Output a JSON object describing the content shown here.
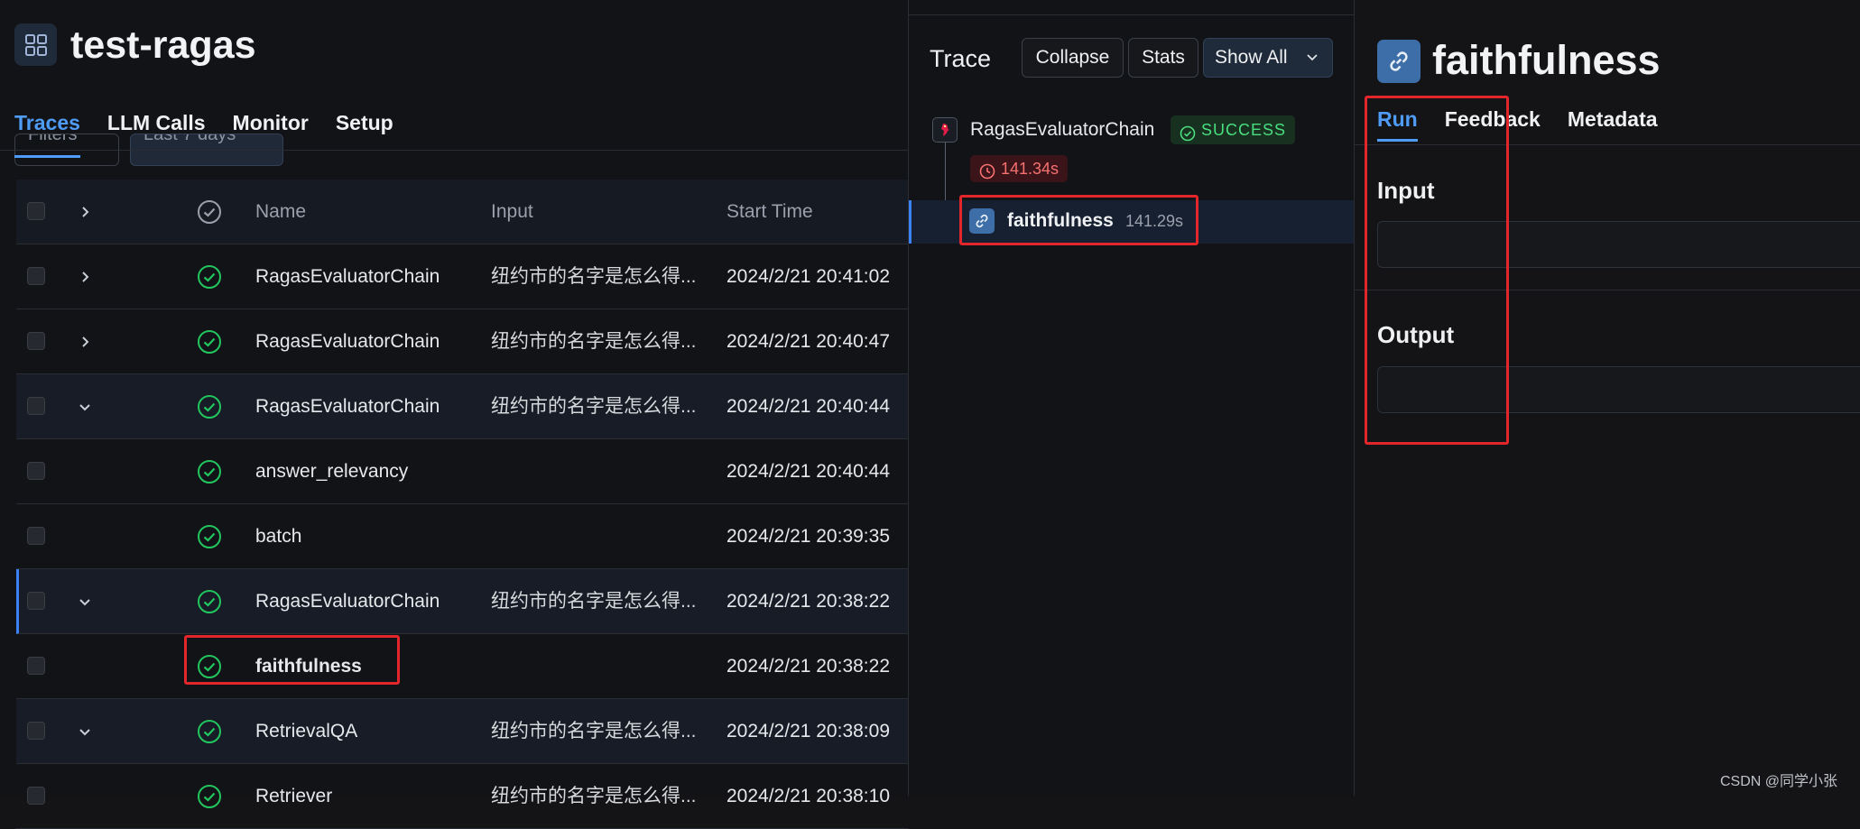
{
  "project": {
    "title": "test-ragas",
    "icon": "grid-icon"
  },
  "tabs": [
    {
      "label": "Traces",
      "active": true
    },
    {
      "label": "LLM Calls",
      "active": false
    },
    {
      "label": "Monitor",
      "active": false
    },
    {
      "label": "Setup",
      "active": false
    }
  ],
  "filters": {
    "filters_label": "Filters",
    "range_label": "Last 7 days"
  },
  "table": {
    "columns": {
      "name": "Name",
      "input": "Input",
      "start_time": "Start Time"
    },
    "rows": [
      {
        "expander": "right",
        "name": "RagasEvaluatorChain",
        "input": "纽约市的名字是怎么得...",
        "time": "2024/2/21 20:41:02"
      },
      {
        "expander": "right",
        "name": "RagasEvaluatorChain",
        "input": "纽约市的名字是怎么得...",
        "time": "2024/2/21 20:40:47"
      },
      {
        "expander": "down",
        "name": "RagasEvaluatorChain",
        "input": "纽约市的名字是怎么得...",
        "time": "2024/2/21 20:40:44"
      },
      {
        "expander": "none",
        "name": "answer_relevancy",
        "input": "",
        "time": "2024/2/21 20:40:44"
      },
      {
        "expander": "none",
        "name": "batch",
        "input": "",
        "time": "2024/2/21 20:39:35"
      },
      {
        "expander": "down",
        "name": "RagasEvaluatorChain",
        "input": "纽约市的名字是怎么得...",
        "time": "2024/2/21 20:38:22"
      },
      {
        "expander": "none",
        "name": "faithfulness",
        "input": "",
        "time": "2024/2/21 20:38:22"
      },
      {
        "expander": "down",
        "name": "RetrievalQA",
        "input": "纽约市的名字是怎么得...",
        "time": "2024/2/21 20:38:09"
      },
      {
        "expander": "none",
        "name": "Retriever",
        "input": "纽约市的名字是怎么得...",
        "time": "2024/2/21 20:38:10"
      }
    ]
  },
  "trace": {
    "title": "Trace",
    "collapse_label": "Collapse",
    "stats_label": "Stats",
    "show_all_label": "Show All",
    "root": {
      "name": "RagasEvaluatorChain",
      "status": "SUCCESS",
      "duration": "141.34s"
    },
    "child": {
      "name": "faithfulness",
      "duration": "141.29s"
    }
  },
  "run": {
    "title": "faithfulness",
    "tabs": [
      {
        "label": "Run",
        "active": true
      },
      {
        "label": "Feedback",
        "active": false
      },
      {
        "label": "Metadata",
        "active": false
      }
    ],
    "input_label": "Input",
    "output_label": "Output"
  },
  "colors": {
    "accent": "#4f9cf7",
    "success": "#4ade80",
    "error": "#f87171",
    "annotation": "#e3262c"
  },
  "watermark": "CSDN @同学小张"
}
